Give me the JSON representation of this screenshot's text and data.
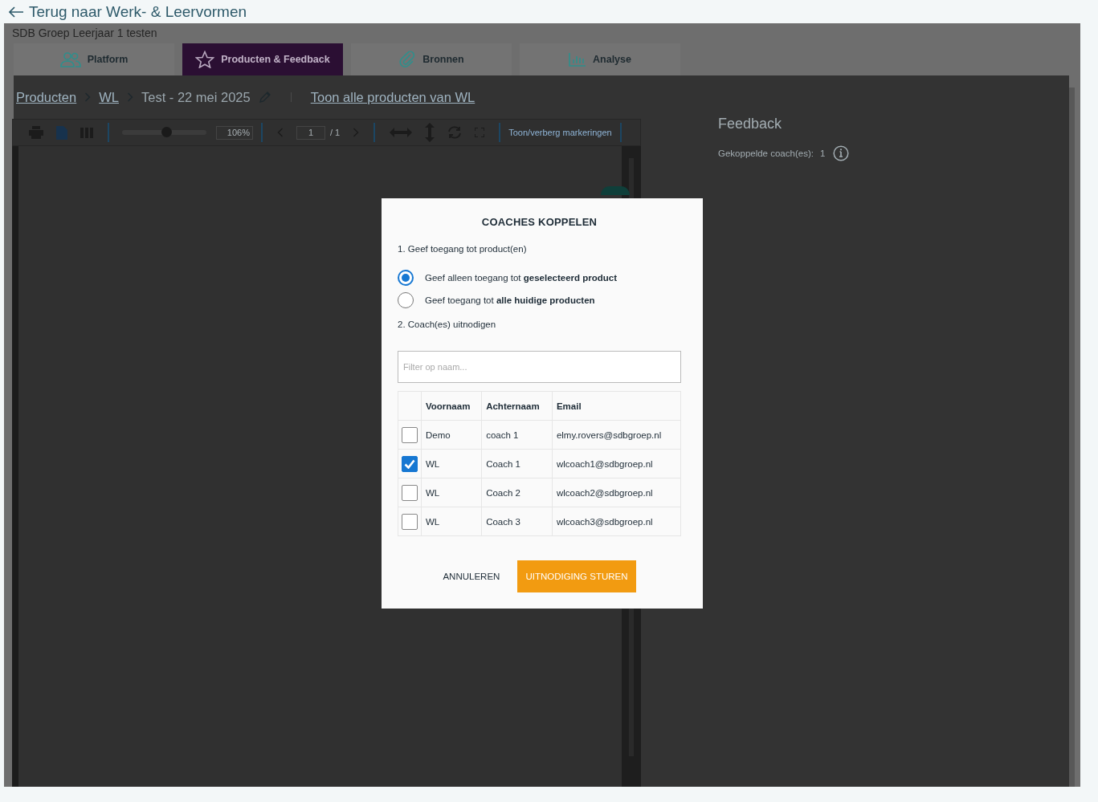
{
  "back_link": "Terug naar Werk- & Leervormen",
  "group_title": "SDB Groep Leerjaar 1 testen",
  "tabs": [
    {
      "label": "Platform",
      "kind": "people",
      "selected": false
    },
    {
      "label": "Producten & Feedback",
      "kind": "star",
      "selected": true
    },
    {
      "label": "Bronnen",
      "kind": "paperclip",
      "selected": false
    },
    {
      "label": "Analyse",
      "kind": "chart",
      "selected": false
    }
  ],
  "breadcrumb": {
    "items": [
      {
        "label": "Producten",
        "link": true
      },
      {
        "label": "WL",
        "link": true
      },
      {
        "label": "Test - 22 mei 2025",
        "link": false
      }
    ],
    "all_products_link": "Toon alle producten van WL"
  },
  "viewer_toolbar": {
    "zoom": {
      "level": 0.52
    },
    "zoom_value": "106%",
    "page": "1",
    "page_total": "/ 1",
    "markings_toggle": "Toon/verberg markeringen"
  },
  "feedback": {
    "title": "Feedback",
    "coaches_label": "Gekoppelde coach(es):",
    "coaches_count": "1"
  },
  "dialog": {
    "title": "COACHES KOPPELEN",
    "step1": "1. Geef toegang tot product(en)",
    "options": [
      {
        "label": "Geef alleen toegang tot **geselecteerd product**",
        "selected": true
      },
      {
        "label": "Geef toegang tot **alle huidige producten**",
        "selected": false
      }
    ],
    "step2": "2. Coach(es) uitnodigen",
    "filter": {
      "placeholder": "Filter op naam..."
    },
    "table": {
      "columns": [
        "Voornaam",
        "Achternaam",
        "Email"
      ],
      "rows": [
        {
          "checked": false,
          "cells": [
            "Demo",
            "coach 1",
            "elmy.rovers@sdbgroep.nl"
          ]
        },
        {
          "checked": true,
          "cells": [
            "WL",
            "Coach 1",
            "wlcoach1@sdbgroep.nl"
          ]
        },
        {
          "checked": false,
          "cells": [
            "WL",
            "Coach 2",
            "wlcoach2@sdbgroep.nl"
          ]
        },
        {
          "checked": false,
          "cells": [
            "WL",
            "Coach 3",
            "wlcoach3@sdbgroep.nl"
          ]
        }
      ]
    },
    "buttons": {
      "cancel": "ANNULEREN",
      "submit": "UITNODIGING STUREN"
    }
  }
}
